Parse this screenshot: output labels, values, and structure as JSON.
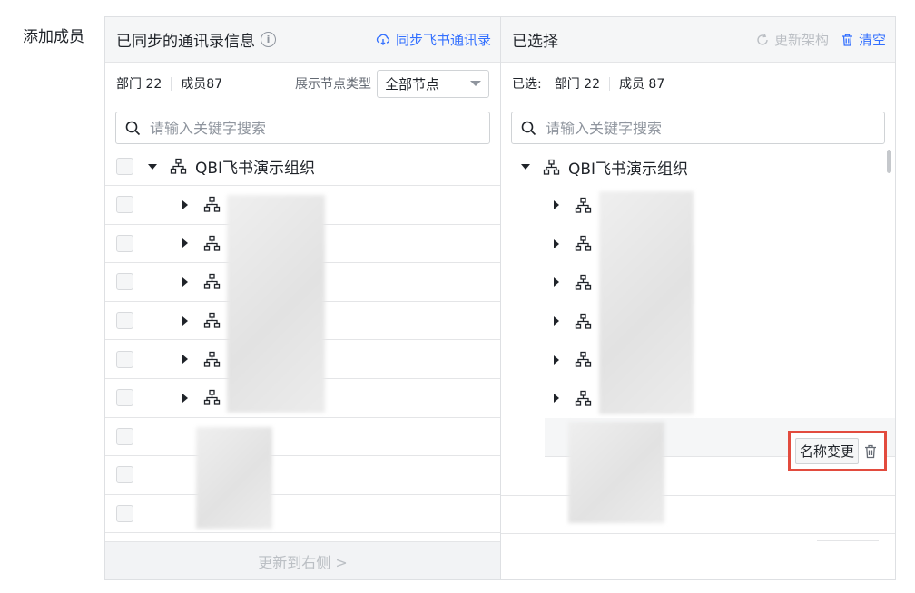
{
  "field_label": "添加成员",
  "left_panel": {
    "title": "已同步的通讯录信息",
    "info_icon": "info-circle-icon",
    "sync_action": "同步飞书通讯录",
    "sync_icon": "cloud-sync-icon",
    "stats": {
      "dept": "部门 22",
      "members": "成员87"
    },
    "node_type_label": "展示节点类型",
    "node_type_value": "全部节点",
    "search_placeholder": "请输入关键字搜索",
    "root_name": "QBI飞书演示组织",
    "footer_button": "更新到右侧 >"
  },
  "right_panel": {
    "title": "已选择",
    "refresh_action": "更新架构",
    "refresh_icon": "refresh-icon",
    "clear_action": "清空",
    "clear_icon": "trash-icon",
    "stats": {
      "selected_label": "已选:",
      "dept": "部门 22",
      "members": "成员 87"
    },
    "search_placeholder": "请输入关键字搜索",
    "root_name": "QBI飞书演示组织",
    "rename_button": "名称变更",
    "delete_icon": "trash-icon"
  },
  "colors": {
    "accent": "#3370ff",
    "highlight": "#e24b3e",
    "disabled": "#bbbfc4"
  }
}
